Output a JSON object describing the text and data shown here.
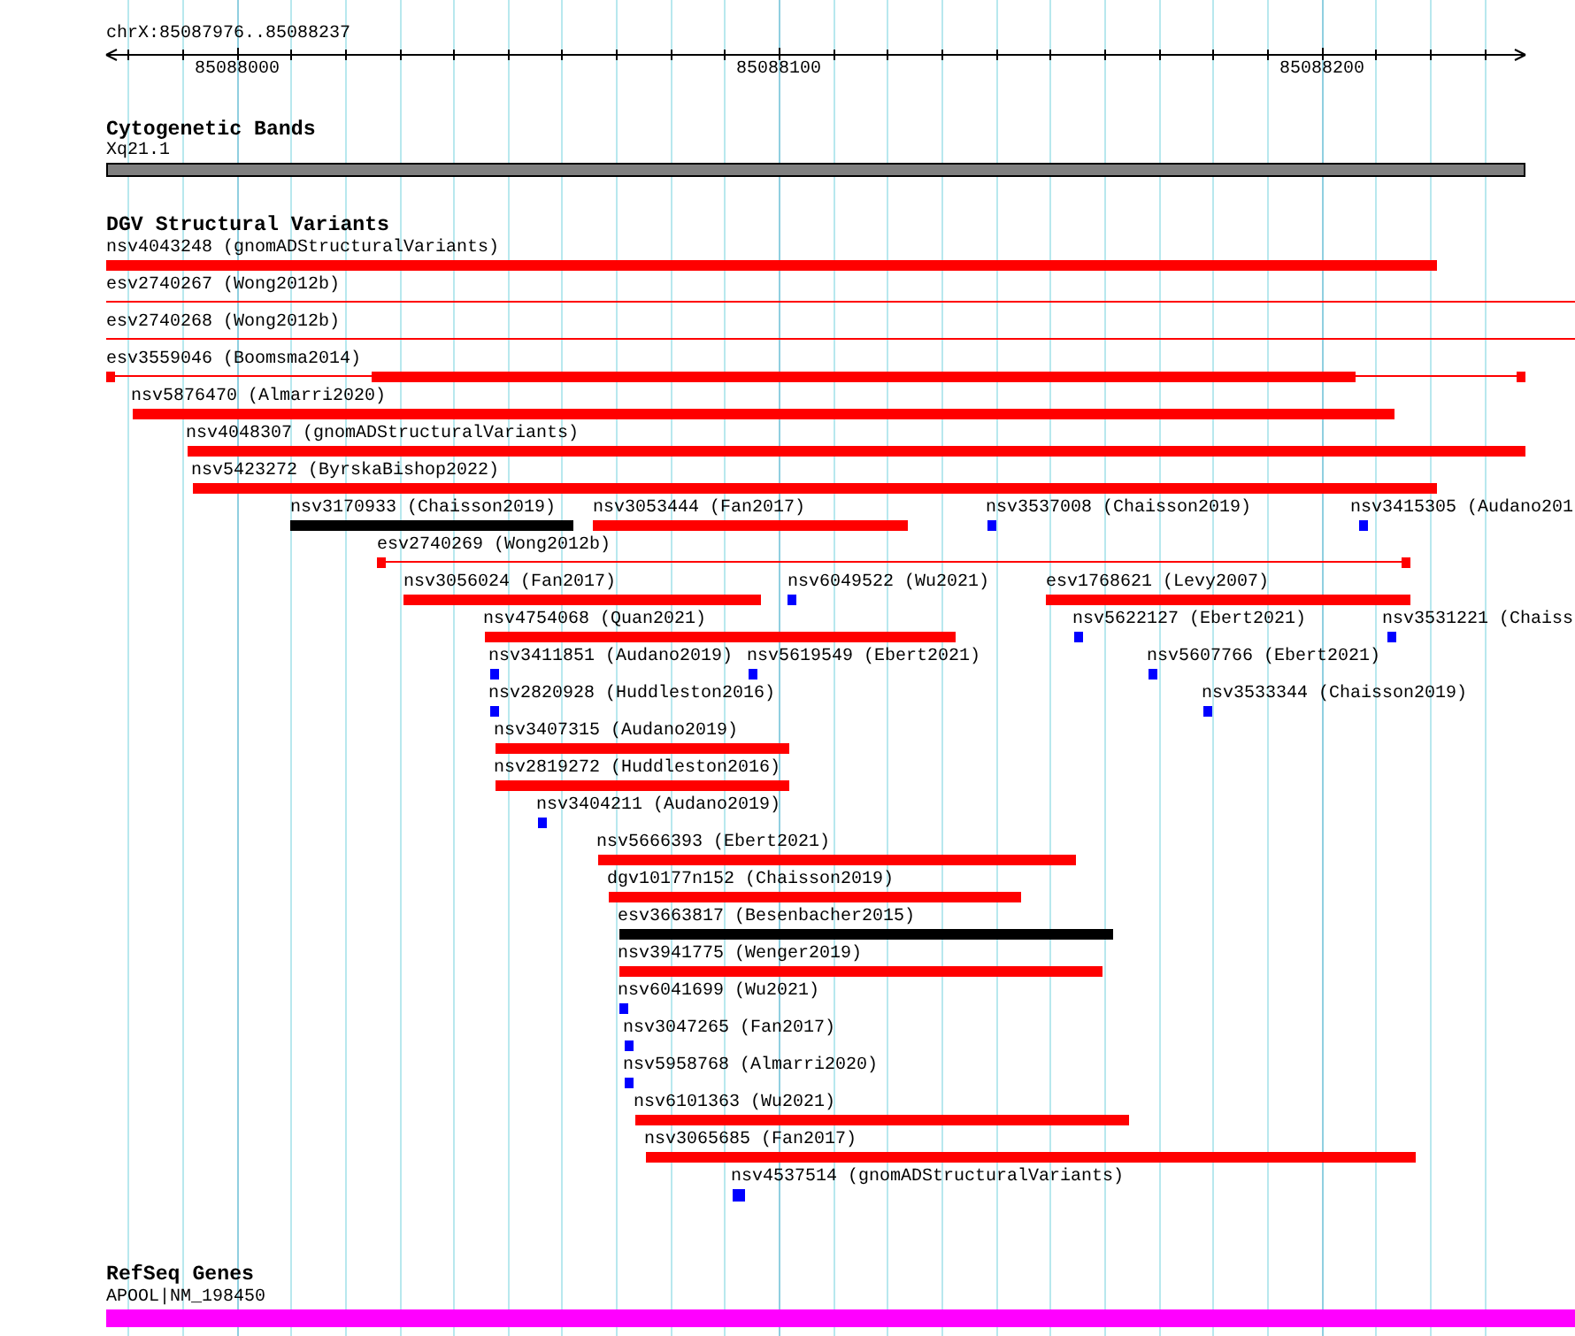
{
  "ruler": {
    "location": "chrX:85087976..85088237",
    "ticks": [
      "85088000",
      "85088100",
      "85088200"
    ]
  },
  "tracks": [
    {
      "kind": "cytoband",
      "title": "Cytogenetic Bands",
      "features": [
        {
          "label": "Xq21.1",
          "color": "#808080"
        }
      ]
    },
    {
      "kind": "variants",
      "title": "DGV Structural Variants",
      "features": [
        {
          "label": "nsv4043248 (gnomADStructuralVariants)",
          "kind": "bar",
          "color": "#ff0000"
        },
        {
          "label": "esv2740267 (Wong2012b)",
          "kind": "line",
          "color": "#ff0000"
        },
        {
          "label": "esv2740268 (Wong2012b)",
          "kind": "line",
          "color": "#ff0000"
        },
        {
          "label": "esv3559046 (Boomsma2014)",
          "kind": "split",
          "color": "#ff0000"
        },
        {
          "label": "nsv5876470 (Almarri2020)",
          "kind": "bar",
          "color": "#ff0000"
        },
        {
          "label": "nsv4048307 (gnomADStructuralVariants)",
          "kind": "bar",
          "color": "#ff0000"
        },
        {
          "label": "nsv5423272 (ByrskaBishop2022)",
          "kind": "bar",
          "color": "#ff0000"
        },
        {
          "label": "nsv3170933 (Chaisson2019)",
          "kind": "bar",
          "color": "#000000"
        },
        {
          "label": "nsv3053444 (Fan2017)",
          "kind": "bar",
          "color": "#ff0000"
        },
        {
          "label": "nsv3537008 (Chaisson2019)",
          "kind": "point",
          "color": "#0000ff"
        },
        {
          "label": "nsv3415305 (Audano201",
          "kind": "point",
          "color": "#0000ff"
        },
        {
          "label": "esv2740269 (Wong2012b)",
          "kind": "line",
          "color": "#ff0000"
        },
        {
          "label": "nsv3056024 (Fan2017)",
          "kind": "bar",
          "color": "#ff0000"
        },
        {
          "label": "nsv6049522 (Wu2021)",
          "kind": "point",
          "color": "#0000ff"
        },
        {
          "label": "esv1768621 (Levy2007)",
          "kind": "bar",
          "color": "#ff0000"
        },
        {
          "label": "nsv4754068 (Quan2021)",
          "kind": "bar",
          "color": "#ff0000"
        },
        {
          "label": "nsv5622127 (Ebert2021)",
          "kind": "point",
          "color": "#0000ff"
        },
        {
          "label": "nsv3531221 (Chaiss",
          "kind": "point",
          "color": "#0000ff"
        },
        {
          "label": "nsv3411851 (Audano2019)",
          "kind": "point",
          "color": "#0000ff"
        },
        {
          "label": "nsv5619549 (Ebert2021)",
          "kind": "point",
          "color": "#0000ff"
        },
        {
          "label": "nsv5607766 (Ebert2021)",
          "kind": "point",
          "color": "#0000ff"
        },
        {
          "label": "nsv2820928 (Huddleston2016)",
          "kind": "point",
          "color": "#0000ff"
        },
        {
          "label": "nsv3533344 (Chaisson2019)",
          "kind": "point",
          "color": "#0000ff"
        },
        {
          "label": "nsv3407315 (Audano2019)",
          "kind": "bar",
          "color": "#ff0000"
        },
        {
          "label": "nsv2819272 (Huddleston2016)",
          "kind": "bar",
          "color": "#ff0000"
        },
        {
          "label": "nsv3404211 (Audano2019)",
          "kind": "point",
          "color": "#0000ff"
        },
        {
          "label": "nsv5666393 (Ebert2021)",
          "kind": "bar",
          "color": "#ff0000"
        },
        {
          "label": "dgv10177n152 (Chaisson2019)",
          "kind": "bar",
          "color": "#ff0000"
        },
        {
          "label": "esv3663817 (Besenbacher2015)",
          "kind": "bar",
          "color": "#000000"
        },
        {
          "label": "nsv3941775 (Wenger2019)",
          "kind": "bar",
          "color": "#ff0000"
        },
        {
          "label": "nsv6041699 (Wu2021)",
          "kind": "point",
          "color": "#0000ff"
        },
        {
          "label": "nsv3047265 (Fan2017)",
          "kind": "point",
          "color": "#0000ff"
        },
        {
          "label": "nsv5958768 (Almarri2020)",
          "kind": "point",
          "color": "#0000ff"
        },
        {
          "label": "nsv6101363 (Wu2021)",
          "kind": "bar",
          "color": "#ff0000"
        },
        {
          "label": "nsv3065685 (Fan2017)",
          "kind": "bar",
          "color": "#ff0000"
        },
        {
          "label": "nsv4537514 (gnomADStructuralVariants)",
          "kind": "point",
          "color": "#0000ff"
        }
      ]
    },
    {
      "kind": "genes",
      "title": "RefSeq Genes",
      "features": [
        {
          "label": "APOOL|NM_198450",
          "color": "#ff00ff"
        }
      ]
    }
  ]
}
